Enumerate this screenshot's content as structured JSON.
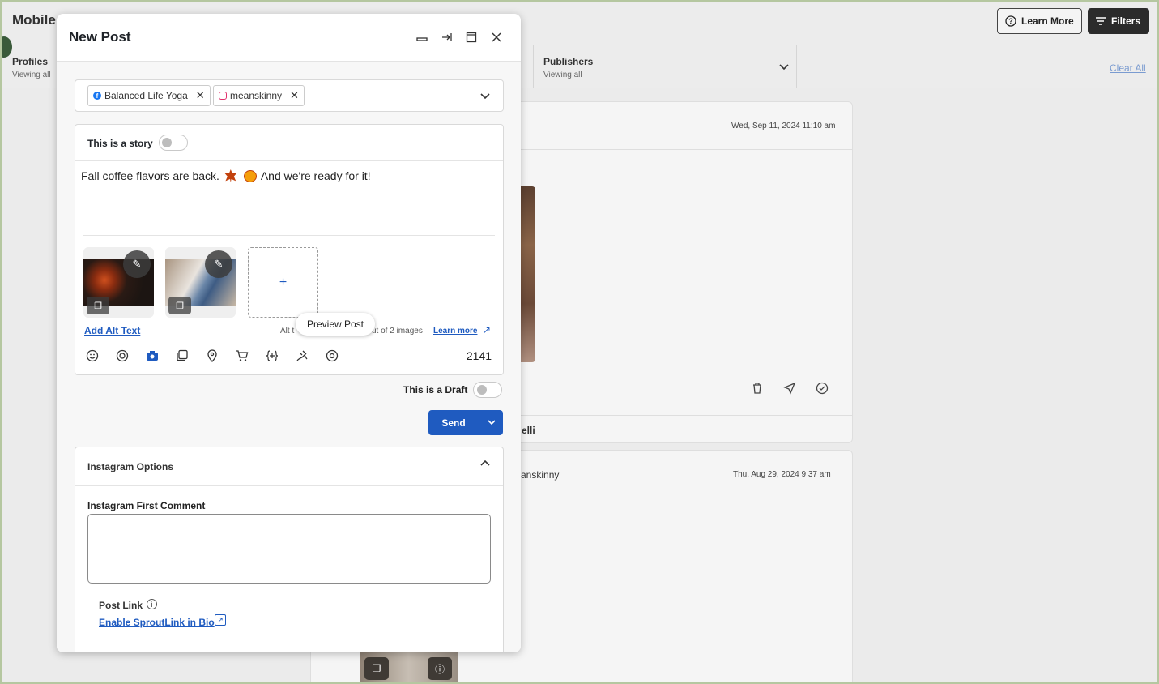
{
  "background": {
    "app_title": "Mobile",
    "learn_more_label": "Learn More",
    "filters_label": "Filters",
    "profiles_filter": {
      "title": "Profiles",
      "subtitle": "Viewing all"
    },
    "publishers_filter": {
      "title": "Publishers",
      "subtitle": "Viewing all"
    },
    "clear_all_label": "Clear All",
    "cards": [
      {
        "date": "Wed, Sep 11, 2024 11:10 am",
        "footer_name_fragment": "elli"
      },
      {
        "name_fragment": "anskinny",
        "date": "Thu, Aug 29, 2024 9:37 am"
      }
    ]
  },
  "modal": {
    "title": "New Post",
    "controls": [
      "minimize-icon",
      "dock-icon",
      "maximize-icon",
      "close-icon"
    ],
    "selected_profiles": [
      {
        "network": "facebook",
        "name": "Balanced Life Yoga"
      },
      {
        "network": "instagram",
        "name": "meanskinny"
      }
    ],
    "story_toggle_label": "This is a story",
    "story_toggle_on": false,
    "post_text_before": "Fall coffee flavors are back.",
    "post_text_after": "And we're ready for it!",
    "media_count": 2,
    "add_alt_text_label": "Add Alt Text",
    "alt_status_prefix": "Alt t",
    "alt_status_suffix": "ut of 2 images",
    "learn_more_label": "Learn more",
    "tooltip": "Preview Post",
    "toolbar_icons": [
      "emoji-icon",
      "ai-assist-icon",
      "camera-icon",
      "media-library-icon",
      "location-icon",
      "product-tag-icon",
      "variables-icon",
      "hashtag-icon",
      "preview-icon"
    ],
    "character_count": "2141",
    "draft_toggle_label": "This is a Draft",
    "draft_toggle_on": false,
    "send_label": "Send",
    "instagram_options": {
      "title": "Instagram Options",
      "first_comment_label": "Instagram First Comment",
      "first_comment_value": "",
      "post_link_label": "Post Link",
      "sproutlink_label": "Enable SproutLink in Bio"
    }
  },
  "colors": {
    "accent": "#1f5bc0",
    "facebook": "#1877f2",
    "instagram": "#e1306c"
  }
}
